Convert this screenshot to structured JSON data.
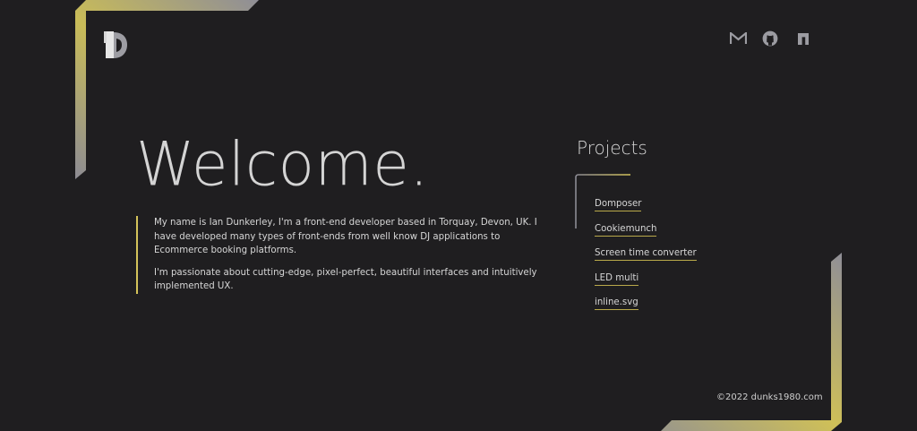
{
  "logo": {
    "icon": "monogram-logo-icon"
  },
  "social": [
    {
      "name": "gmail-icon"
    },
    {
      "name": "github-icon"
    },
    {
      "name": "linkedin-icon"
    }
  ],
  "hero": {
    "title": "Welcome.",
    "paragraphs": [
      "My name is Ian Dunkerley, I'm a front-end developer based in Torquay, Devon, UK. I have developed many types of front-ends from well know DJ applications to Ecommerce booking platforms.",
      "I'm passionate about cutting-edge, pixel-perfect, beautiful interfaces and intuitively implemented UX."
    ]
  },
  "projects": {
    "title": "Projects",
    "items": [
      "Domposer",
      "Cookiemunch",
      "Screen time converter",
      "LED multi",
      "inline.svg"
    ]
  },
  "footer": {
    "copyright": "©2022 dunks1980.com"
  },
  "colors": {
    "background": "#1f1e20",
    "accent_gold": "#d4c35a",
    "accent_grey": "#8f8f96",
    "text": "#d6d6d6"
  }
}
